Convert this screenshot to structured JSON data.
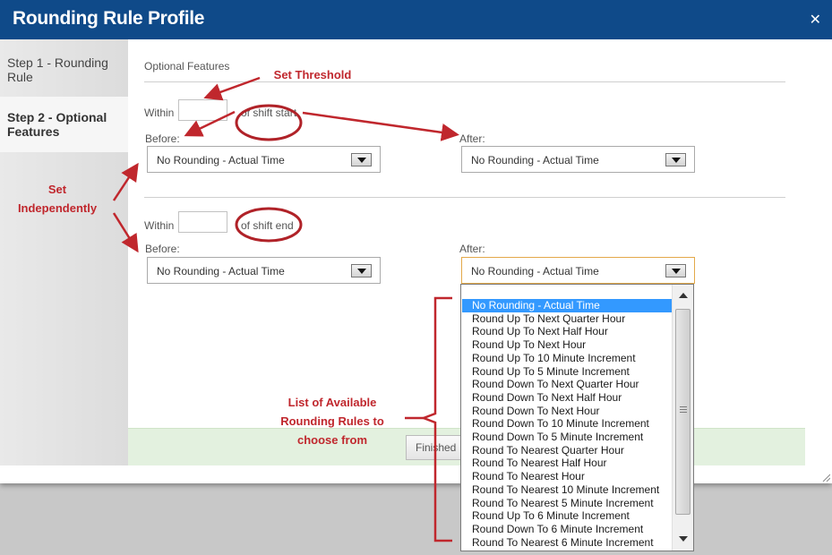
{
  "dialog": {
    "title": "Rounding Rule Profile",
    "close_icon": "close-icon"
  },
  "sidebar": {
    "items": [
      {
        "label": "Step 1 - Rounding Rule"
      },
      {
        "label": "Step 2 - Optional Features"
      }
    ]
  },
  "main": {
    "section_title": "Optional Features",
    "shift_start": {
      "within_label": "Within",
      "within_value": "",
      "suffix": "of shift start",
      "before_label": "Before:",
      "before_value": "No Rounding - Actual Time",
      "after_label": "After:",
      "after_value": "No Rounding - Actual Time"
    },
    "shift_end": {
      "within_label": "Within",
      "within_value": "",
      "suffix": "of shift end",
      "before_label": "Before:",
      "before_value": "No Rounding - Actual Time",
      "after_label": "After:",
      "after_value": "No Rounding - Actual Time"
    },
    "finish_label": "Finished"
  },
  "dropdown": {
    "selected_index": 0,
    "options": [
      "No Rounding - Actual Time",
      "Round Up To Next Quarter Hour",
      "Round Up To Next Half Hour",
      "Round Up To Next Hour",
      "Round Up To 10 Minute Increment",
      "Round Up To 5 Minute Increment",
      "Round Down To Next Quarter Hour",
      "Round Down To Next Half Hour",
      "Round Down To Next Hour",
      "Round Down To 10 Minute Increment",
      "Round Down To 5 Minute Increment",
      "Round To Nearest Quarter Hour",
      "Round To Nearest Half Hour",
      "Round To Nearest Hour",
      "Round To Nearest 10 Minute Increment",
      "Round To Nearest 5 Minute Increment",
      "Round Up To 6 Minute Increment",
      "Round Down To 6 Minute Increment",
      "Round To Nearest 6 Minute Increment"
    ]
  },
  "annotations": {
    "set_threshold": "Set Threshold",
    "set_independently_1": "Set",
    "set_independently_2": "Independently",
    "list_1": "List of Available",
    "list_2": "Rounding Rules to",
    "list_3": "choose from"
  },
  "colors": {
    "titlebar": "#0f4a89",
    "annotation": "#c0272d",
    "highlight": "#3399ff",
    "footer": "#e3f1df"
  }
}
